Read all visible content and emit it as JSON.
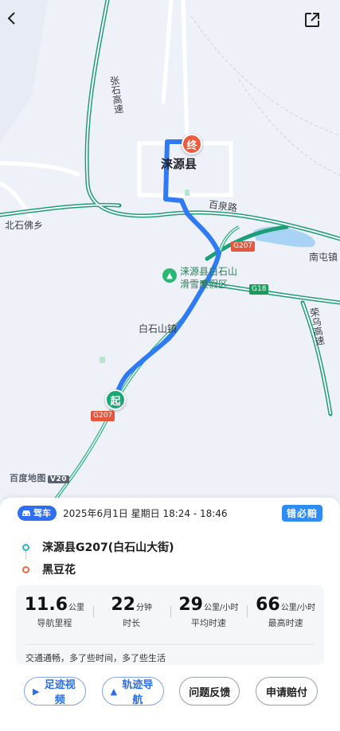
{
  "map": {
    "labels": {
      "county": "涞源县",
      "road_baiquan": "百泉路",
      "town_beishi": "北石佛乡",
      "town_nantun": "南屯镇",
      "resort_line1": "涞源县白石山",
      "resort_line2": "滑雪度假区",
      "baishishan": "白石山镇",
      "expressway_zs": "张石高速",
      "expressway_ls": "荣乌高速",
      "shield_g207_a": "G207",
      "shield_g207_b": "G207",
      "shield_g18": "G18"
    },
    "end_pin": "终",
    "start_pin": "起",
    "logo": "百度地图",
    "logo_version": "V20",
    "route_color": "#2f7bf5"
  },
  "nav": {
    "back_icon": "back-arrow-icon",
    "share_icon": "share-icon"
  },
  "trip": {
    "mode": "驾车",
    "datetime": "2025年6月1日 星期日 18:24 - 18:46",
    "badge": "错必赔",
    "start": "涞源县G207(白石山大街)",
    "end": "黑豆花",
    "stats": [
      {
        "value": "11.6",
        "unit": "公里",
        "label": "导航里程"
      },
      {
        "value": "22",
        "unit": "分钟",
        "label": "时长"
      },
      {
        "value": "29",
        "unit": "公里/小时",
        "label": "平均时速"
      },
      {
        "value": "66",
        "unit": "公里/小时",
        "label": "最高时速"
      }
    ],
    "note": "交通通畅，多了些时间，多了些生活"
  },
  "actions": {
    "footprint_video": "足迹视频",
    "track_nav": "轨迹导航",
    "feedback": "问题反馈",
    "claim": "申请赔付"
  }
}
